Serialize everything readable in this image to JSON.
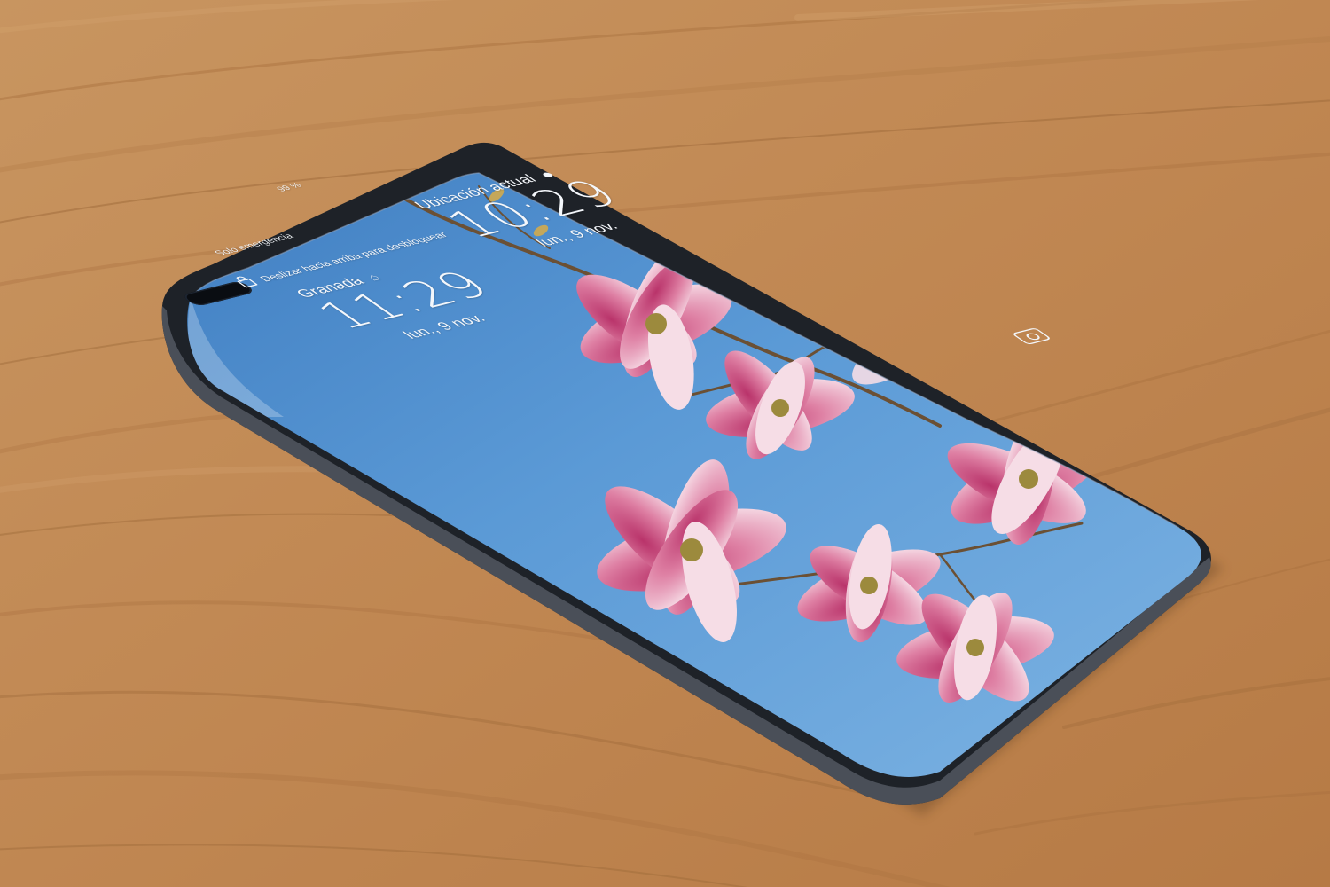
{
  "lock_screen": {
    "status_bar": {
      "battery": "99 %"
    },
    "emergency_label": "Solo emergencia",
    "unlock_hint": "Deslizar hacia arriba para desbloquear",
    "clock_home": {
      "city": "Granada",
      "time": "11:29",
      "date": "lun., 9 nov."
    },
    "clock_current": {
      "city": "Ubicación actual",
      "time": "10:29",
      "date": "lun., 9 nov."
    }
  },
  "icons": {
    "lock": "lock-icon",
    "home": "home-icon",
    "location": "location-icon",
    "camera": "camera-icon"
  },
  "colors": {
    "wood": "#c8935f",
    "wood_dark": "#a8713f",
    "sky": "#4d90cf",
    "sky_light": "#8dbde8",
    "blossom_pink": "#d25b86",
    "blossom_light": "#f6dde6",
    "frame": "#2b2f36"
  }
}
